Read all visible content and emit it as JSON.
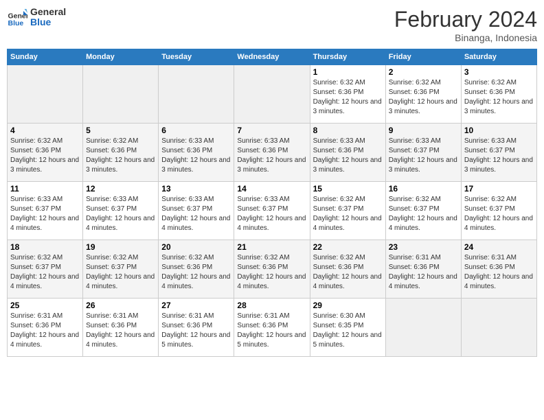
{
  "header": {
    "logo_line1": "General",
    "logo_line2": "Blue",
    "month_title": "February 2024",
    "location": "Binanga, Indonesia"
  },
  "days_of_week": [
    "Sunday",
    "Monday",
    "Tuesday",
    "Wednesday",
    "Thursday",
    "Friday",
    "Saturday"
  ],
  "weeks": [
    [
      {
        "day": "",
        "empty": true
      },
      {
        "day": "",
        "empty": true
      },
      {
        "day": "",
        "empty": true
      },
      {
        "day": "",
        "empty": true
      },
      {
        "day": "1",
        "sunrise": "6:32 AM",
        "sunset": "6:36 PM",
        "daylight": "12 hours and 3 minutes."
      },
      {
        "day": "2",
        "sunrise": "6:32 AM",
        "sunset": "6:36 PM",
        "daylight": "12 hours and 3 minutes."
      },
      {
        "day": "3",
        "sunrise": "6:32 AM",
        "sunset": "6:36 PM",
        "daylight": "12 hours and 3 minutes."
      }
    ],
    [
      {
        "day": "4",
        "sunrise": "6:32 AM",
        "sunset": "6:36 PM",
        "daylight": "12 hours and 3 minutes."
      },
      {
        "day": "5",
        "sunrise": "6:32 AM",
        "sunset": "6:36 PM",
        "daylight": "12 hours and 3 minutes."
      },
      {
        "day": "6",
        "sunrise": "6:33 AM",
        "sunset": "6:36 PM",
        "daylight": "12 hours and 3 minutes."
      },
      {
        "day": "7",
        "sunrise": "6:33 AM",
        "sunset": "6:36 PM",
        "daylight": "12 hours and 3 minutes."
      },
      {
        "day": "8",
        "sunrise": "6:33 AM",
        "sunset": "6:36 PM",
        "daylight": "12 hours and 3 minutes."
      },
      {
        "day": "9",
        "sunrise": "6:33 AM",
        "sunset": "6:37 PM",
        "daylight": "12 hours and 3 minutes."
      },
      {
        "day": "10",
        "sunrise": "6:33 AM",
        "sunset": "6:37 PM",
        "daylight": "12 hours and 3 minutes."
      }
    ],
    [
      {
        "day": "11",
        "sunrise": "6:33 AM",
        "sunset": "6:37 PM",
        "daylight": "12 hours and 4 minutes."
      },
      {
        "day": "12",
        "sunrise": "6:33 AM",
        "sunset": "6:37 PM",
        "daylight": "12 hours and 4 minutes."
      },
      {
        "day": "13",
        "sunrise": "6:33 AM",
        "sunset": "6:37 PM",
        "daylight": "12 hours and 4 minutes."
      },
      {
        "day": "14",
        "sunrise": "6:33 AM",
        "sunset": "6:37 PM",
        "daylight": "12 hours and 4 minutes."
      },
      {
        "day": "15",
        "sunrise": "6:32 AM",
        "sunset": "6:37 PM",
        "daylight": "12 hours and 4 minutes."
      },
      {
        "day": "16",
        "sunrise": "6:32 AM",
        "sunset": "6:37 PM",
        "daylight": "12 hours and 4 minutes."
      },
      {
        "day": "17",
        "sunrise": "6:32 AM",
        "sunset": "6:37 PM",
        "daylight": "12 hours and 4 minutes."
      }
    ],
    [
      {
        "day": "18",
        "sunrise": "6:32 AM",
        "sunset": "6:37 PM",
        "daylight": "12 hours and 4 minutes."
      },
      {
        "day": "19",
        "sunrise": "6:32 AM",
        "sunset": "6:37 PM",
        "daylight": "12 hours and 4 minutes."
      },
      {
        "day": "20",
        "sunrise": "6:32 AM",
        "sunset": "6:36 PM",
        "daylight": "12 hours and 4 minutes."
      },
      {
        "day": "21",
        "sunrise": "6:32 AM",
        "sunset": "6:36 PM",
        "daylight": "12 hours and 4 minutes."
      },
      {
        "day": "22",
        "sunrise": "6:32 AM",
        "sunset": "6:36 PM",
        "daylight": "12 hours and 4 minutes."
      },
      {
        "day": "23",
        "sunrise": "6:31 AM",
        "sunset": "6:36 PM",
        "daylight": "12 hours and 4 minutes."
      },
      {
        "day": "24",
        "sunrise": "6:31 AM",
        "sunset": "6:36 PM",
        "daylight": "12 hours and 4 minutes."
      }
    ],
    [
      {
        "day": "25",
        "sunrise": "6:31 AM",
        "sunset": "6:36 PM",
        "daylight": "12 hours and 4 minutes."
      },
      {
        "day": "26",
        "sunrise": "6:31 AM",
        "sunset": "6:36 PM",
        "daylight": "12 hours and 4 minutes."
      },
      {
        "day": "27",
        "sunrise": "6:31 AM",
        "sunset": "6:36 PM",
        "daylight": "12 hours and 5 minutes."
      },
      {
        "day": "28",
        "sunrise": "6:31 AM",
        "sunset": "6:36 PM",
        "daylight": "12 hours and 5 minutes."
      },
      {
        "day": "29",
        "sunrise": "6:30 AM",
        "sunset": "6:35 PM",
        "daylight": "12 hours and 5 minutes."
      },
      {
        "day": "",
        "empty": true
      },
      {
        "day": "",
        "empty": true
      }
    ]
  ]
}
